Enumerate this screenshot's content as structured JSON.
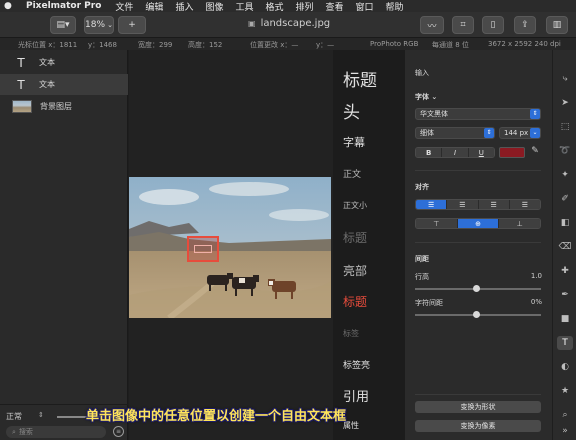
{
  "menubar": {
    "app": "Pixelmator Pro",
    "items": [
      "文件",
      "编辑",
      "插入",
      "图像",
      "工具",
      "格式",
      "排列",
      "查看",
      "窗口",
      "帮助"
    ]
  },
  "toolbar": {
    "zoom": "18%",
    "add": "+",
    "doc_title": "landscape.jpg"
  },
  "infobar": {
    "cursor_x": "光标位置 x：1811",
    "cursor_y": "y：1468",
    "width": "宽度：299",
    "height": "高度：152",
    "pos_x": "位置更改 x：—",
    "pos_y": "y：—",
    "color_profile": "ProPhoto RGB",
    "bit_depth": "每通道 8 位",
    "resolution": "3672 x 2592 240 dpi"
  },
  "layers": [
    {
      "name": "文本",
      "icon": "T"
    },
    {
      "name": "文本",
      "icon": "T"
    },
    {
      "name": "背景图层",
      "icon": "thumb"
    }
  ],
  "layers_footer": {
    "blend_mode": "正常",
    "search_placeholder": "搜索"
  },
  "styles": [
    "标题",
    "头",
    "字幕",
    "正文",
    "正文小",
    "标题",
    "亮部",
    "标题",
    "标签",
    "标签亮",
    "引用",
    "属性"
  ],
  "inspector": {
    "input_label": "输入",
    "font_label": "字体",
    "font_family": "华文黑体",
    "font_weight": "细体",
    "font_size": "144 px",
    "style_buttons": [
      "B",
      "I",
      "U"
    ],
    "text_color": "#8b1a22",
    "align_label": "对齐",
    "spacing_label": "间距",
    "line_height_label": "行高",
    "line_height_value": "1.0",
    "char_spacing_label": "字符间距",
    "char_spacing_value": "0%",
    "convert_shape": "变换为形状",
    "convert_pixels": "变换为像素"
  },
  "caption": "单击图像中的任意位置以创建一个自由文本框",
  "colors": {
    "accent": "#2d6fd8",
    "selection_box": "#e74c3c"
  }
}
